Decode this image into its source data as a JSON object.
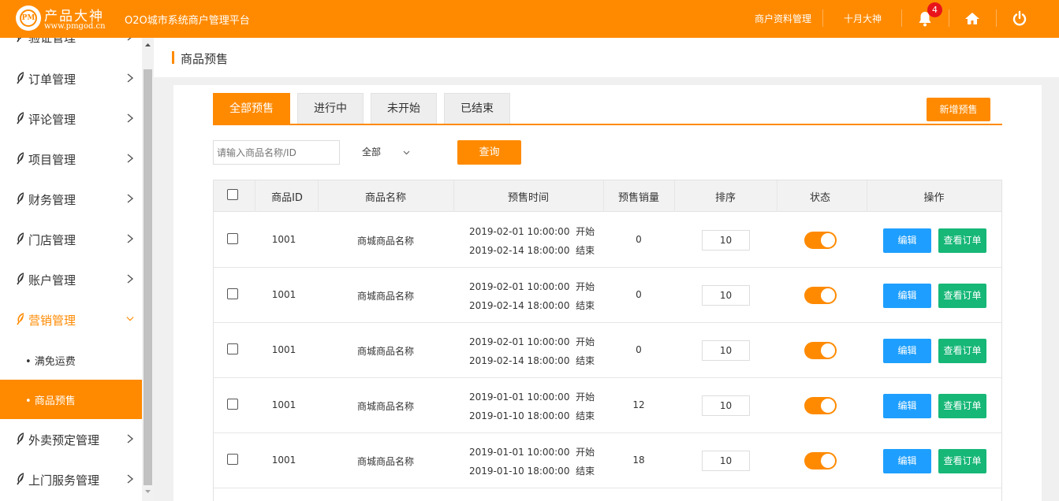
{
  "colors": {
    "accent": "#ff8a00",
    "blue": "#1e9fff",
    "green": "#16b777",
    "badge": "#e8141a"
  },
  "header": {
    "brand_mark": "PM",
    "brand_name": "产品大神",
    "brand_url": "www.pmgod.cn",
    "platform_title": "O2O城市系统商户管理平台",
    "merchant_link": "商户资料管理",
    "user_name": "十月大神",
    "notification_count": "4",
    "icons": [
      "bell-icon",
      "home-icon",
      "power-icon"
    ]
  },
  "sidebar": {
    "items": [
      {
        "label": "验证管理"
      },
      {
        "label": "订单管理"
      },
      {
        "label": "评论管理"
      },
      {
        "label": "项目管理"
      },
      {
        "label": "财务管理"
      },
      {
        "label": "门店管理"
      },
      {
        "label": "账户管理"
      },
      {
        "label": "营销管理"
      },
      {
        "label": "外卖预定管理"
      },
      {
        "label": "上门服务管理"
      }
    ],
    "sub_items": [
      {
        "label": "• 满免运费"
      },
      {
        "label": "• 商品预售"
      }
    ]
  },
  "page": {
    "breadcrumb": "商品预售"
  },
  "tabs": [
    {
      "label": "全部预售"
    },
    {
      "label": "进行中"
    },
    {
      "label": "未开始"
    },
    {
      "label": "已结束"
    }
  ],
  "add_button": "新增预售",
  "search": {
    "placeholder": "请输入商品名称/ID",
    "select_value": "全部",
    "query_button": "查询"
  },
  "table": {
    "headers": [
      "商品ID",
      "商品名称",
      "预售时间",
      "预售销量",
      "排序",
      "状态",
      "操作"
    ],
    "edit_label": "编辑",
    "orders_label": "查看订单",
    "start_suffix": "开始",
    "end_suffix": "结束",
    "rows": [
      {
        "id": "1001",
        "name": "商城商品名称",
        "start": "2019-02-01 10:00:00",
        "end": "2019-02-14 18:00:00",
        "sales": "0",
        "sort": "10"
      },
      {
        "id": "1001",
        "name": "商城商品名称",
        "start": "2019-02-01 10:00:00",
        "end": "2019-02-14 18:00:00",
        "sales": "0",
        "sort": "10"
      },
      {
        "id": "1001",
        "name": "商城商品名称",
        "start": "2019-02-01 10:00:00",
        "end": "2019-02-14 18:00:00",
        "sales": "0",
        "sort": "10"
      },
      {
        "id": "1001",
        "name": "商城商品名称",
        "start": "2019-01-01 10:00:00",
        "end": "2019-01-10 18:00:00",
        "sales": "12",
        "sort": "10"
      },
      {
        "id": "1001",
        "name": "商城商品名称",
        "start": "2019-01-01 10:00:00",
        "end": "2019-01-10 18:00:00",
        "sales": "18",
        "sort": "10"
      }
    ]
  }
}
